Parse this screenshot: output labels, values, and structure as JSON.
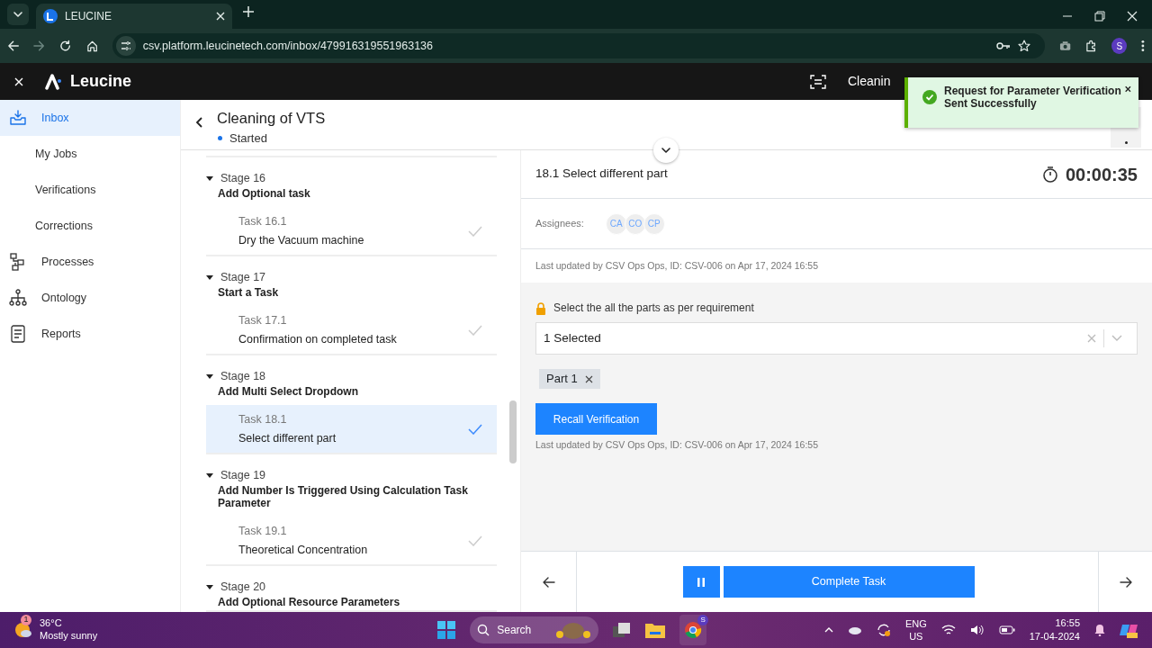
{
  "browser": {
    "tab_title": "LEUCINE",
    "url": "csv.platform.leucinetech.com/inbox/479916319551963136",
    "profile": "S"
  },
  "app": {
    "brand": "Leucine",
    "header_items": [
      "Cleanin"
    ]
  },
  "sidebar": {
    "items": [
      {
        "label": "Inbox",
        "kind": "main",
        "selected": true
      },
      {
        "label": "My Jobs",
        "kind": "sub",
        "selected": false
      },
      {
        "label": "Verifications",
        "kind": "sub",
        "selected": false
      },
      {
        "label": "Corrections",
        "kind": "sub",
        "selected": false
      },
      {
        "label": "Processes",
        "kind": "main",
        "selected": false
      },
      {
        "label": "Ontology",
        "kind": "main",
        "selected": false
      },
      {
        "label": "Reports",
        "kind": "main",
        "selected": false
      }
    ]
  },
  "job": {
    "title": "Cleaning of VTS",
    "status": "Started"
  },
  "stages": [
    {
      "label": "Stage 16",
      "name": "Add Optional task",
      "expanded": true,
      "tasks": [
        {
          "number": "Task 16.1",
          "name": "Dry the Vacuum machine",
          "selected": false
        }
      ]
    },
    {
      "label": "Stage 17",
      "name": "Start a Task",
      "expanded": true,
      "tasks": [
        {
          "number": "Task 17.1",
          "name": "Confirmation on completed task",
          "selected": false
        }
      ]
    },
    {
      "label": "Stage 18",
      "name": "Add Multi Select Dropdown",
      "expanded": true,
      "tasks": [
        {
          "number": "Task 18.1",
          "name": "Select different part",
          "selected": true
        }
      ]
    },
    {
      "label": "Stage 19",
      "name": "Add Number Is Triggered Using Calculation Task Parameter",
      "expanded": true,
      "tasks": [
        {
          "number": "Task 19.1",
          "name": "Theoretical Concentration",
          "selected": false
        }
      ]
    },
    {
      "label": "Stage 20",
      "name": "Add Optional Resource Parameters",
      "expanded": true
    }
  ],
  "task": {
    "title": "18.1 Select different part",
    "timer": "00:00:35",
    "assignees_label": "Assignees:",
    "assignees": [
      "CA",
      "CO",
      "CP"
    ],
    "updated": "Last updated by CSV Ops Ops, ID: CSV-006 on Apr 17, 2024 16:55",
    "parameter": {
      "label": "Select the all the parts as per requirement",
      "locked": true,
      "value": "1 Selected",
      "chips": [
        "Part 1"
      ]
    },
    "action": "Recall Verification",
    "action_updated": "Last updated by CSV Ops Ops, ID: CSV-006 on Apr 17, 2024 16:55"
  },
  "footer": {
    "complete": "Complete Task"
  },
  "toast": {
    "kind": "success",
    "message": "Request for Parameter Verification Sent Successfully"
  },
  "taskbar": {
    "weather_badge": "1",
    "temperature": "36°C",
    "weather": "Mostly sunny",
    "search": "Search",
    "language": "ENG",
    "region": "US",
    "time": "16:55",
    "date": "17-04-2024",
    "chrome_badge": "S"
  }
}
